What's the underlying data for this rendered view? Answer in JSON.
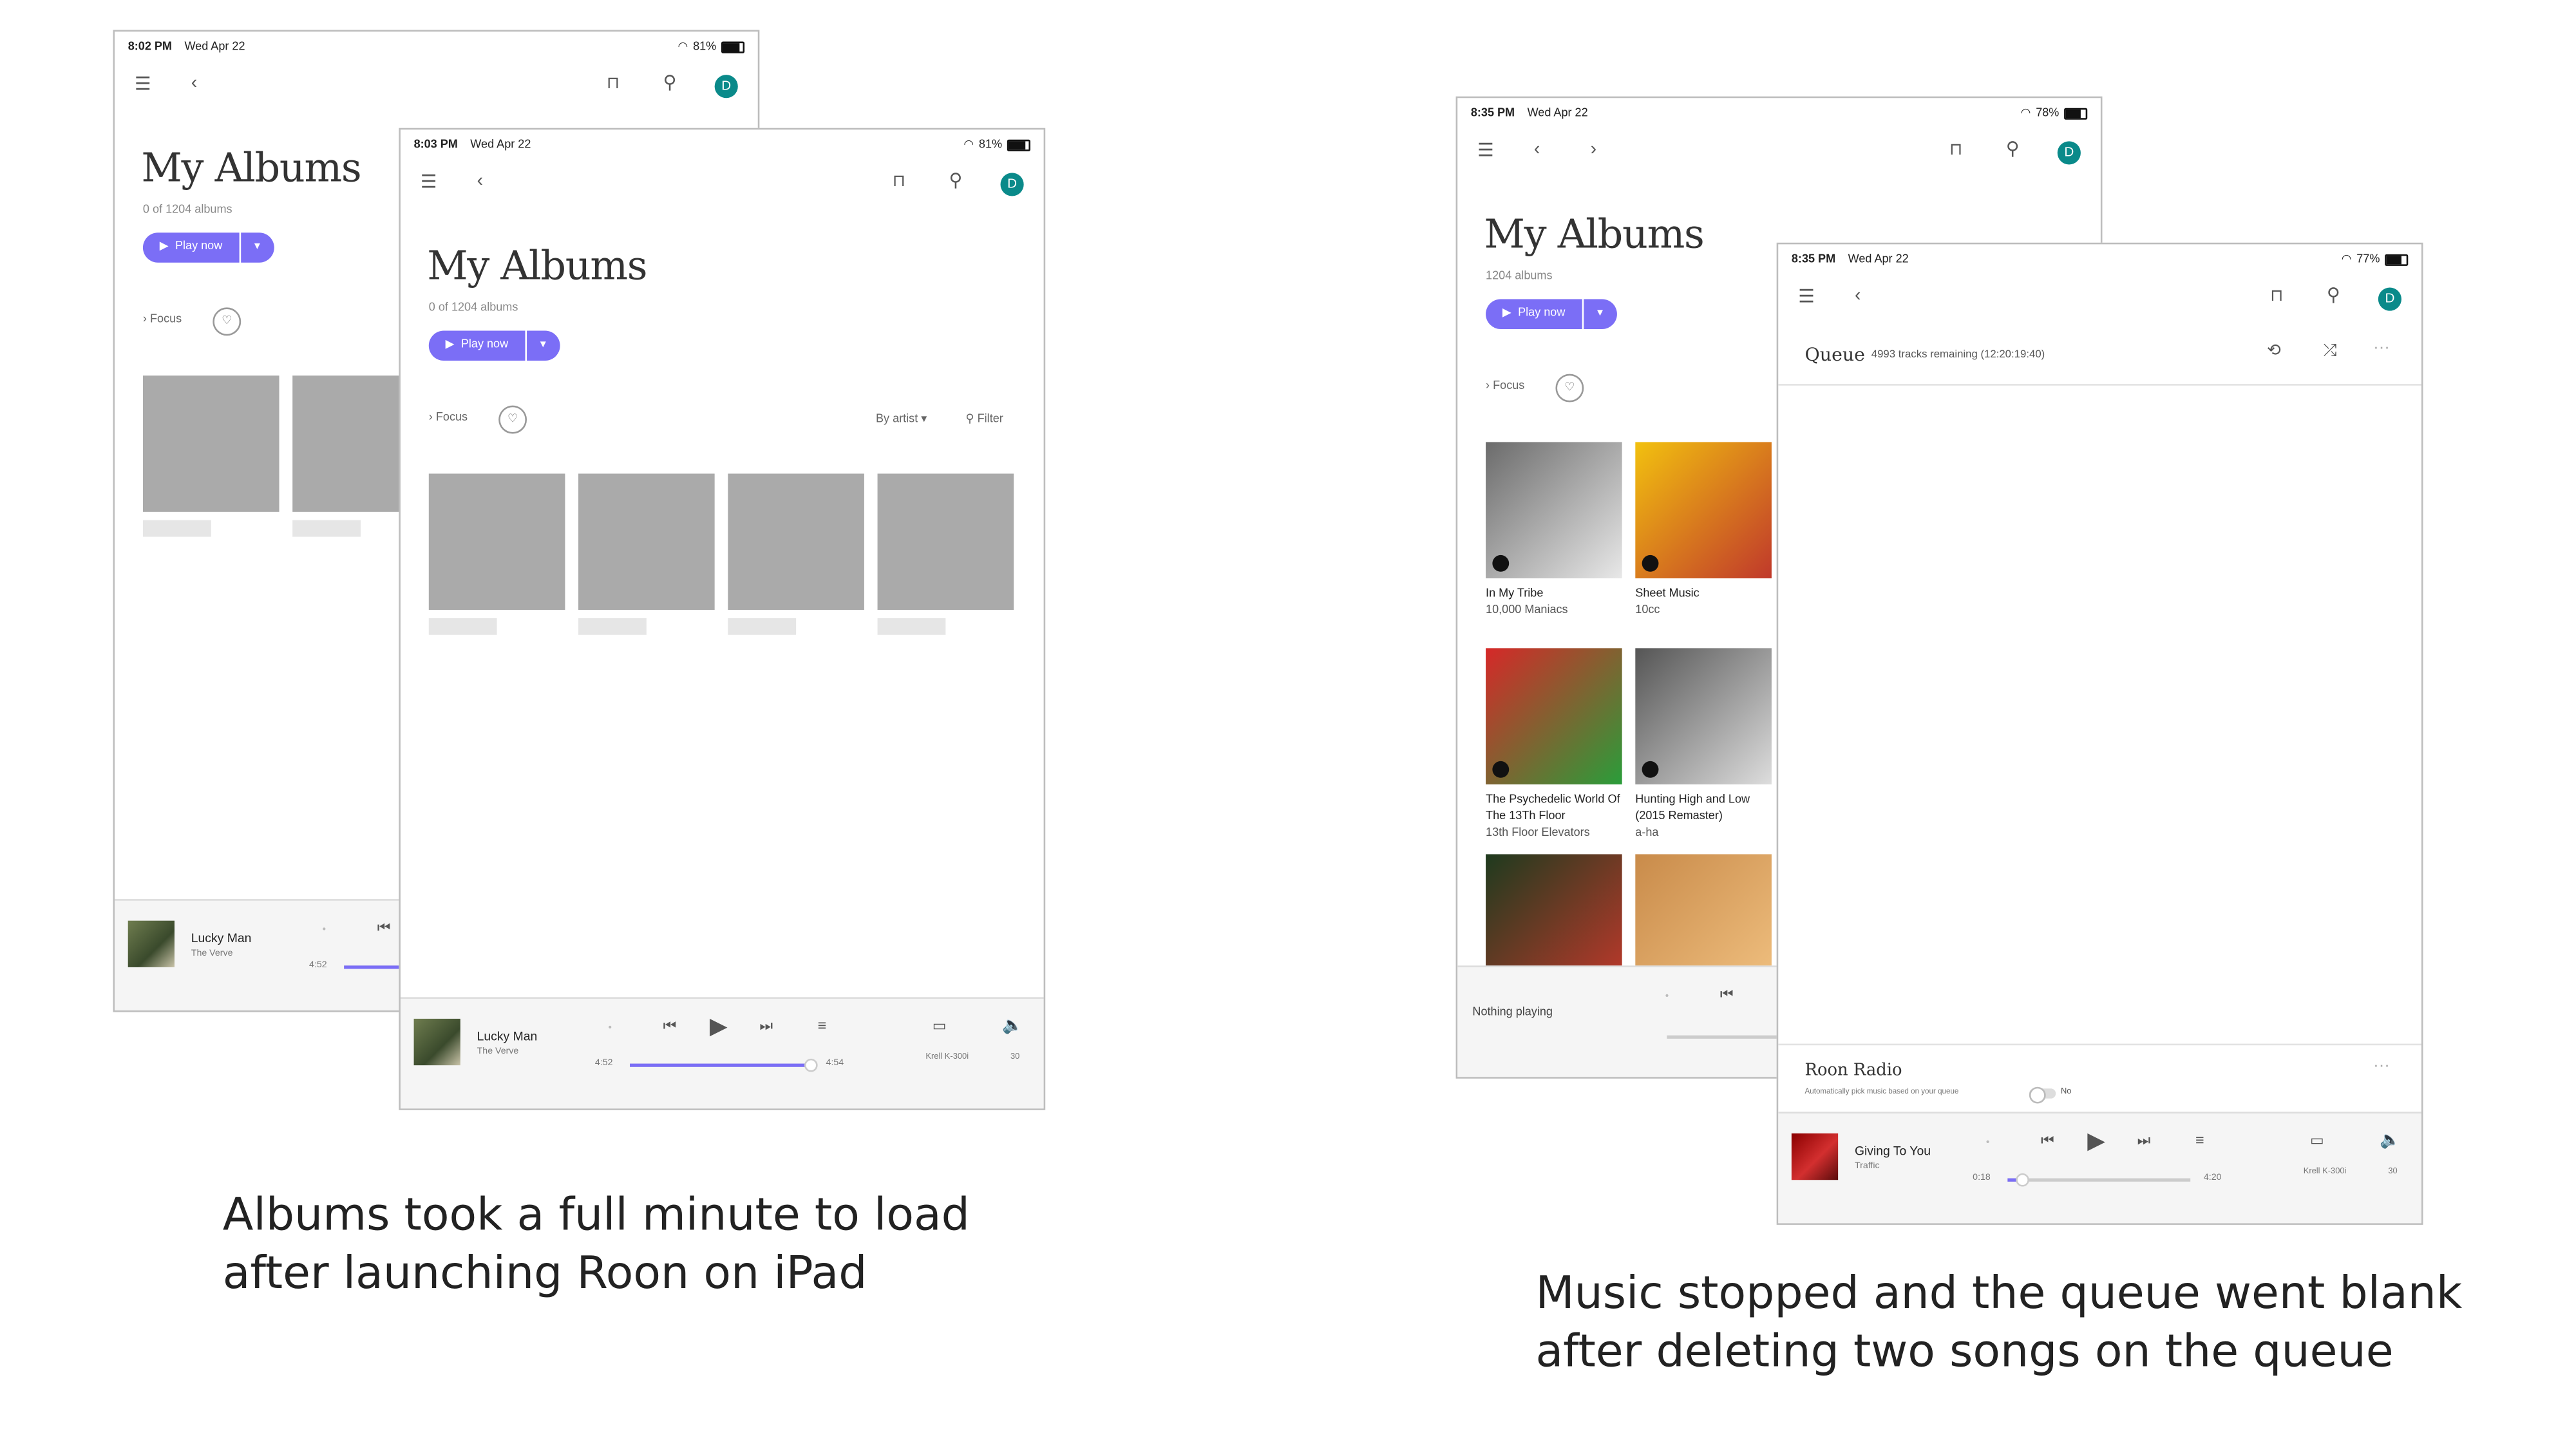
{
  "screens": {
    "a1": {
      "time": "8:02 PM",
      "date": "Wed Apr 22",
      "battery": "81%",
      "title": "My Albums",
      "count": "0 of 1204 albums",
      "play": "Play now",
      "focus": "Focus",
      "track": "Lucky Man",
      "artist": "The Verve",
      "elapsed": "4:52"
    },
    "a2": {
      "time": "8:03 PM",
      "date": "Wed Apr 22",
      "battery": "81%",
      "title": "My Albums",
      "count": "0 of 1204 albums",
      "play": "Play now",
      "focus": "Focus",
      "sort": "By artist",
      "filter": "Filter",
      "track": "Lucky Man",
      "artist": "The Verve",
      "elapsed": "4:52",
      "total": "4:54",
      "zone": "Krell K-300i",
      "volume": "30",
      "progress": 0.98
    },
    "b1": {
      "time": "8:35 PM",
      "date": "Wed Apr 22",
      "battery": "78%",
      "title": "My Albums",
      "count": "1204 albums",
      "play": "Play now",
      "focus": "Focus",
      "albums": [
        {
          "title": "In My Tribe",
          "artist": "10,000 Maniacs",
          "colors": [
            "#6b6b6b",
            "#e8e8e8"
          ]
        },
        {
          "title": "Sheet Music",
          "artist": "10cc",
          "colors": [
            "#f2c10f",
            "#c0392b"
          ]
        },
        {
          "title": "The Psychedelic World Of The 13Th Floor",
          "artist": "13th Floor Elevators",
          "colors": [
            "#d62828",
            "#2a9d3a"
          ]
        },
        {
          "title": "Hunting High and Low (2015 Remaster)",
          "artist": "a-ha",
          "colors": [
            "#555555",
            "#dddddd"
          ]
        },
        {
          "title": "",
          "artist": "",
          "colors": [
            "#1e3a1e",
            "#c0392b"
          ]
        },
        {
          "title": "",
          "artist": "",
          "colors": [
            "#c98b4a",
            "#f0c080"
          ]
        }
      ],
      "nothing": "Nothing playing"
    },
    "b2": {
      "time": "8:35 PM",
      "date": "Wed Apr 22",
      "battery": "77%",
      "queue_title": "Queue",
      "queue_info": "4993 tracks remaining (12:20:19:40)",
      "radio_title": "Roon Radio",
      "radio_desc": "Automatically pick music based on your queue",
      "radio_state": "No",
      "track": "Giving To You",
      "artist": "Traffic",
      "elapsed": "0:18",
      "total": "4:20",
      "zone": "Krell K-300i",
      "volume": "30",
      "progress": 0.07
    }
  },
  "captions": {
    "left_line1": "Albums took a full minute to load",
    "left_line2": "after launching Roon on iPad",
    "right_line1": "Music stopped and the queue went blank",
    "right_line2": "after deleting two songs on the queue"
  },
  "icons": [
    "menu-icon",
    "back-icon",
    "forward-icon",
    "bookmark-icon",
    "search-icon",
    "avatar",
    "play-icon",
    "dropdown-icon",
    "chevron-right-icon",
    "heart-icon",
    "filter-icon",
    "prev-icon",
    "next-icon",
    "queue-icon",
    "speaker-icon",
    "zone-icon",
    "repeat-icon",
    "shuffle-icon",
    "more-icon",
    "wifi-icon",
    "battery-icon"
  ],
  "accent": "#7b6ef6",
  "avatar_letter": "D",
  "avatar_color": "#0a8a8a"
}
